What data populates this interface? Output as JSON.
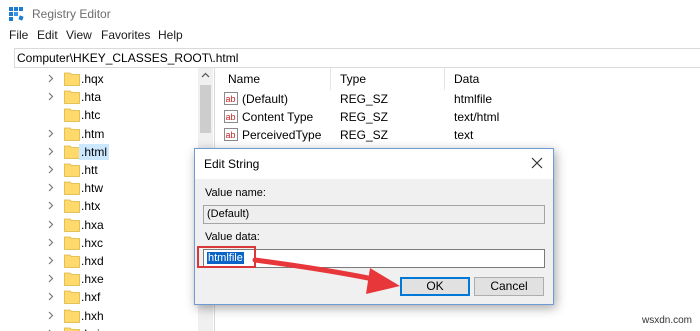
{
  "window": {
    "title": "Registry Editor"
  },
  "menu": [
    "File",
    "Edit",
    "View",
    "Favorites",
    "Help"
  ],
  "address": "Computer\\HKEY_CLASSES_ROOT\\.html",
  "tree": [
    {
      "label": ".hqx",
      "has_children": true,
      "selected": false
    },
    {
      "label": ".hta",
      "has_children": true,
      "selected": false
    },
    {
      "label": ".htc",
      "has_children": false,
      "selected": false
    },
    {
      "label": ".htm",
      "has_children": true,
      "selected": false
    },
    {
      "label": ".html",
      "has_children": true,
      "selected": true
    },
    {
      "label": ".htt",
      "has_children": true,
      "selected": false
    },
    {
      "label": ".htw",
      "has_children": true,
      "selected": false
    },
    {
      "label": ".htx",
      "has_children": true,
      "selected": false
    },
    {
      "label": ".hxa",
      "has_children": true,
      "selected": false
    },
    {
      "label": ".hxc",
      "has_children": true,
      "selected": false
    },
    {
      "label": ".hxd",
      "has_children": true,
      "selected": false
    },
    {
      "label": ".hxe",
      "has_children": true,
      "selected": false
    },
    {
      "label": ".hxf",
      "has_children": true,
      "selected": false
    },
    {
      "label": ".hxh",
      "has_children": true,
      "selected": false
    },
    {
      "label": ".hxi",
      "has_children": true,
      "selected": false
    }
  ],
  "values": {
    "columns": [
      "Name",
      "Type",
      "Data"
    ],
    "rows": [
      {
        "name": "(Default)",
        "type": "REG_SZ",
        "data": "htmlfile",
        "icon": "string-value-icon"
      },
      {
        "name": "Content Type",
        "type": "REG_SZ",
        "data": "text/html",
        "icon": "string-value-icon"
      },
      {
        "name": "PerceivedType",
        "type": "REG_SZ",
        "data": "text",
        "icon": "string-value-icon"
      }
    ]
  },
  "dialog": {
    "title": "Edit String",
    "value_name_label": "Value name:",
    "value_name": "(Default)",
    "value_data_label": "Value data:",
    "value_data": "htmlfile",
    "ok_label": "OK",
    "cancel_label": "Cancel"
  },
  "watermark": "wsxdn.com",
  "colors": {
    "selection": "#cce8ff",
    "text_selection": "#0a64c8",
    "annotation": "#d9383a",
    "ok_border": "#0078d7"
  }
}
